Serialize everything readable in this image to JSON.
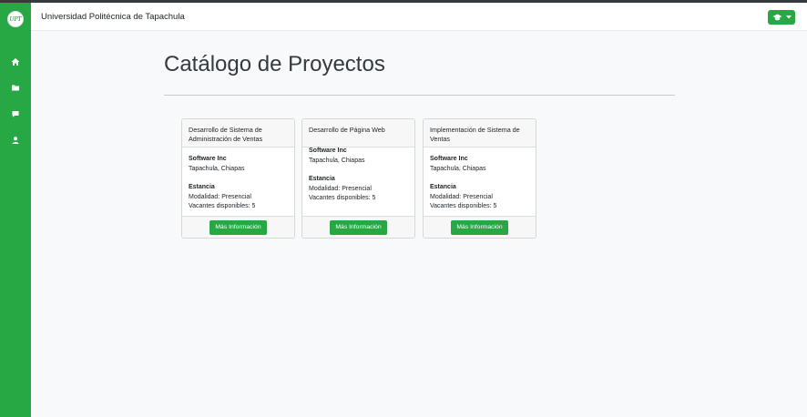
{
  "app": {
    "brand": "Universidad Politécnica de Tapachula",
    "logo_text": "UPT",
    "accent_color": "#28a745"
  },
  "sidebar": {
    "items": [
      {
        "icon": "home-icon"
      },
      {
        "icon": "folder-icon"
      },
      {
        "icon": "comment-icon"
      },
      {
        "icon": "user-icon"
      }
    ]
  },
  "header": {
    "user_menu_icon": "graduation-cap-icon"
  },
  "main": {
    "title": "Catálogo de Proyectos",
    "cards": [
      {
        "title": "Desarrollo de Sistema de Administración de Ventas",
        "company": "Software Inc",
        "location": "Tapachula, Chiapas",
        "type": "Estancia",
        "modality": "Modalidad: Presencial",
        "vacancies": "Vacantes disponibles: 5",
        "button": "Más Información"
      },
      {
        "title": "Desarrollo de Página Web",
        "company": "Software Inc",
        "location": "Tapachula, Chiapas",
        "type": "Estancia",
        "modality": "Modalidad: Presencial",
        "vacancies": "Vacantes disponibles: 5",
        "button": "Más Información"
      },
      {
        "title": "Implementación de Sistema de Ventas",
        "company": "Software Inc",
        "location": "Tapachula, Chiapas",
        "type": "Estancia",
        "modality": "Modalidad: Presencial",
        "vacancies": "Vacantes disponibles: 5",
        "button": "Más Información"
      }
    ]
  }
}
